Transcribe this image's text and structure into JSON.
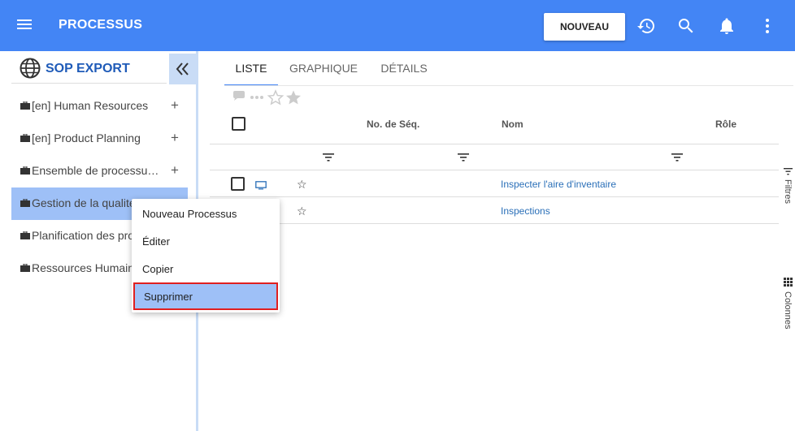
{
  "header": {
    "title": "PROCESSUS",
    "new_button": "NOUVEAU",
    "accent": "#4385f5"
  },
  "sidebar": {
    "title": "SOP EXPORT",
    "items": [
      {
        "label": "[en] Human Resources",
        "has_add": true
      },
      {
        "label": "[en] Product Planning",
        "has_add": true
      },
      {
        "label": "Ensemble de processus…",
        "has_add": true
      },
      {
        "label": "Gestion de la qualité",
        "has_add": false,
        "active": true
      },
      {
        "label": "Planification des processus",
        "has_add": false
      },
      {
        "label": "Ressources Humaines",
        "has_add": false
      }
    ],
    "add_symbol": "+"
  },
  "tabs": [
    {
      "label": "LISTE",
      "active": true
    },
    {
      "label": "GRAPHIQUE"
    },
    {
      "label": "DÉTAILS"
    }
  ],
  "grid": {
    "columns": [
      "No. de Séq.",
      "Nom",
      "Rôle"
    ],
    "rows": [
      {
        "name": "Inspecter l'aire d'inventaire"
      },
      {
        "name": "Inspections"
      }
    ],
    "star_glyph": "☆"
  },
  "side_panels": {
    "filters": "Filtres",
    "columns": "Colonnes"
  },
  "context_menu": {
    "items": [
      "Nouveau Processus",
      "Éditer",
      "Copier",
      "Supprimer"
    ],
    "highlighted": "Supprimer"
  }
}
